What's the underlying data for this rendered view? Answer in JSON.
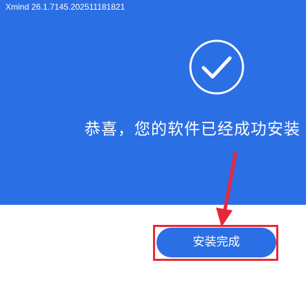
{
  "window": {
    "version_text": "Xmind 26.1.7145.202511181821"
  },
  "hero": {
    "icon": "check-circle-icon",
    "message": "恭喜，您的软件已经成功安装"
  },
  "actions": {
    "finish_label": "安装完成"
  },
  "colors": {
    "hero_background": "#2b6fe4",
    "button_background": "#2b6fe4",
    "annotation": "#e8283a",
    "text": "#ffffff"
  }
}
